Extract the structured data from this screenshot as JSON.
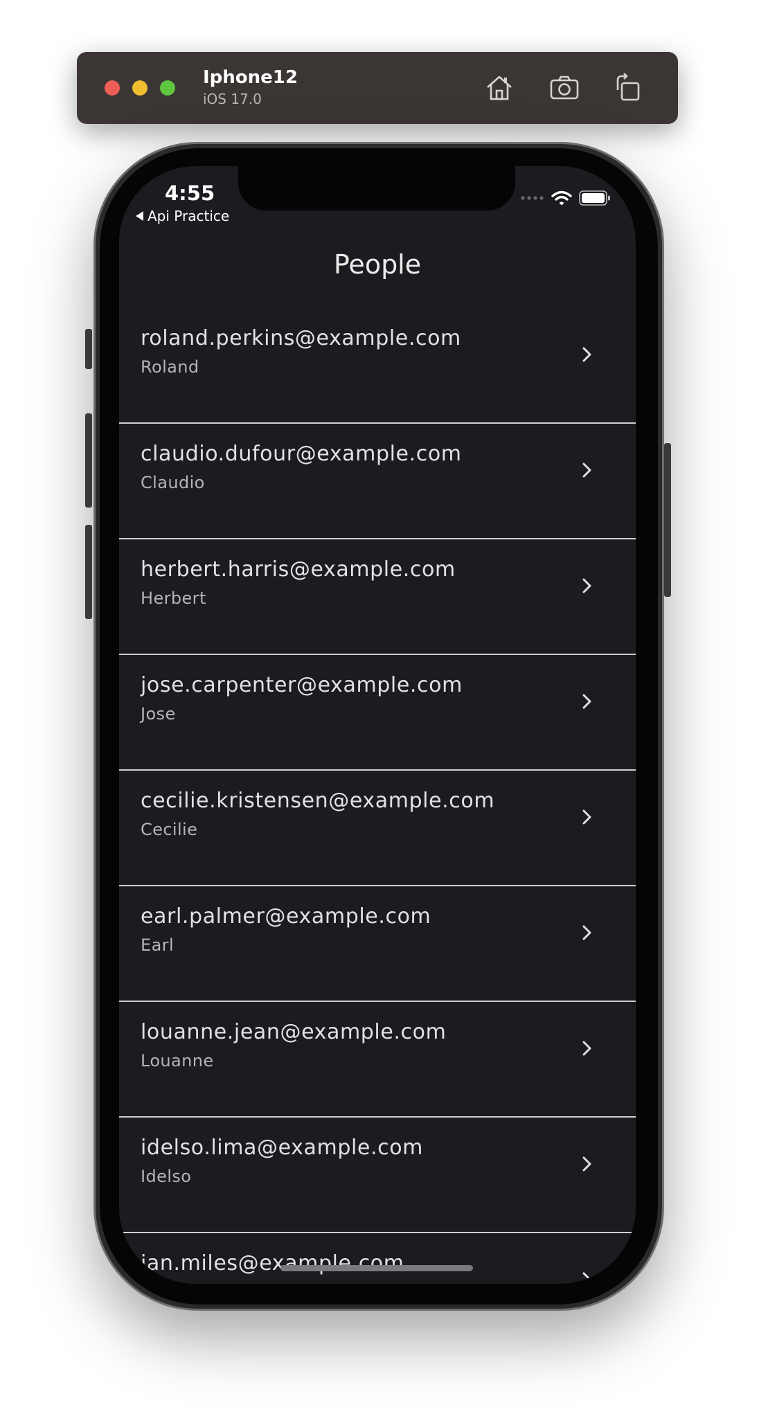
{
  "simulator": {
    "device_name": "Iphone12",
    "os_version": "iOS 17.0",
    "buttons": [
      {
        "icon": "home-icon"
      },
      {
        "icon": "screenshot-camera-icon"
      },
      {
        "icon": "rotate-icon"
      }
    ]
  },
  "status_bar": {
    "time": "4:55",
    "back_app": "Api Practice",
    "icons": [
      "cellular-signal-icon",
      "wifi-icon",
      "battery-icon"
    ]
  },
  "nav": {
    "title": "People"
  },
  "people": [
    {
      "email": "roland.perkins@example.com",
      "name": "Roland"
    },
    {
      "email": "claudio.dufour@example.com",
      "name": "Claudio"
    },
    {
      "email": "herbert.harris@example.com",
      "name": "Herbert"
    },
    {
      "email": "jose.carpenter@example.com",
      "name": "Jose"
    },
    {
      "email": "cecilie.kristensen@example.com",
      "name": "Cecilie"
    },
    {
      "email": "earl.palmer@example.com",
      "name": "Earl"
    },
    {
      "email": "louanne.jean@example.com",
      "name": "Louanne"
    },
    {
      "email": "idelso.lima@example.com",
      "name": "Idelso"
    },
    {
      "email": "ian.miles@example.com",
      "name": ""
    }
  ],
  "colors": {
    "screen_background": "#1c1b20",
    "divider": "#cfcfd2",
    "primary_text": "#e2e2e4",
    "secondary_text": "#b5b5b9"
  }
}
